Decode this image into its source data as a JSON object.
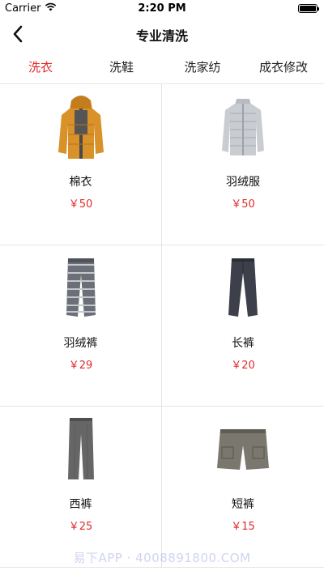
{
  "status_bar": {
    "carrier": "Carrier",
    "time": "2:20 PM"
  },
  "nav": {
    "title": "专业清洗"
  },
  "tabs": [
    {
      "label": "洗衣",
      "active": true
    },
    {
      "label": "洗鞋",
      "active": false
    },
    {
      "label": "洗家纺",
      "active": false
    },
    {
      "label": "成衣修改",
      "active": false
    }
  ],
  "products": [
    {
      "name": "棉衣",
      "price": "￥50",
      "icon": "hooded-jacket-icon",
      "color": "#d9912a"
    },
    {
      "name": "羽绒服",
      "price": "￥50",
      "icon": "down-jacket-icon",
      "color": "#c9ccd1"
    },
    {
      "name": "羽绒裤",
      "price": "￥29",
      "icon": "striped-pants-icon",
      "color": "#6b6f78"
    },
    {
      "name": "长裤",
      "price": "￥20",
      "icon": "long-pants-icon",
      "color": "#3d404a"
    },
    {
      "name": "西裤",
      "price": "￥25",
      "icon": "trousers-icon",
      "color": "#666666"
    },
    {
      "name": "短裤",
      "price": "￥15",
      "icon": "shorts-icon",
      "color": "#7a776f"
    }
  ],
  "colors": {
    "accent": "#e02a2a",
    "divider": "#e5e5e5"
  },
  "watermark": "易下APP · 4008891800.COM"
}
